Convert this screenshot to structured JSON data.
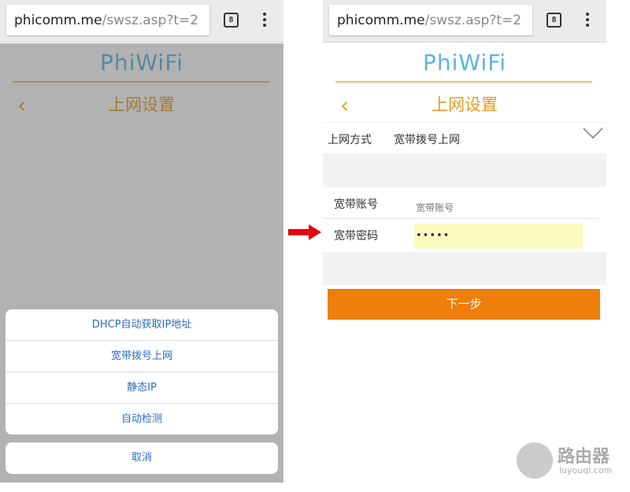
{
  "browser": {
    "url_host": "phicomm.me",
    "url_path": "/swsz.asp?t=2",
    "tab_count": "8"
  },
  "page": {
    "logo": "PhiWiFi",
    "title": "上网设置"
  },
  "action_sheet": {
    "items": [
      {
        "label": "DHCP自动获取IP地址"
      },
      {
        "label": "宽带拨号上网"
      },
      {
        "label": "静态IP"
      },
      {
        "label": "自动检测"
      }
    ],
    "cancel_label": "取消"
  },
  "form": {
    "mode_label": "上网方式",
    "mode_value": "宽带拨号上网",
    "account_label": "宽带账号",
    "account_placeholder": "宽带账号",
    "password_label": "宽带密码",
    "password_value": "•••••",
    "next_label": "下一步"
  },
  "watermark": {
    "title": "路由器",
    "subtitle": "luyouqi.com"
  },
  "colors": {
    "accent_orange": "#ee7f0b",
    "title_orange": "#e69a1e",
    "logo_blue": "#5ab4dc",
    "link_blue": "#2a6bbf",
    "arrow_red": "#e60012"
  }
}
